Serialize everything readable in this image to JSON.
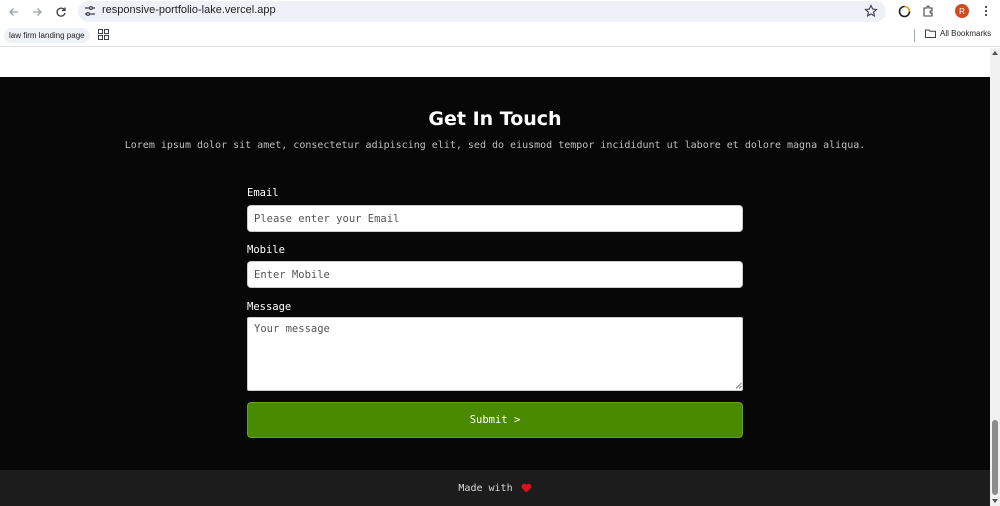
{
  "browser": {
    "url": "responsive-portfolio-lake.vercel.app",
    "profile_initial": "R",
    "bookmarks": [
      {
        "label": "law firm landing page"
      }
    ],
    "all_bookmarks_label": "All Bookmarks"
  },
  "contact": {
    "title": "Get In Touch",
    "subtitle": "Lorem ipsum dolor sit amet, consectetur adipiscing elit, sed do eiusmod tempor incididunt ut labore et dolore magna aliqua.",
    "email": {
      "label": "Email",
      "placeholder": "Please enter your Email",
      "value": ""
    },
    "mobile": {
      "label": "Mobile",
      "placeholder": "Enter Mobile",
      "value": ""
    },
    "message": {
      "label": "Message",
      "placeholder": "Your message",
      "value": ""
    },
    "submit_label": "Submit >"
  },
  "footer": {
    "text": "Made with",
    "heart_color": "#e0101a"
  },
  "colors": {
    "section_bg": "#070707",
    "footer_bg": "#1c1c1c",
    "submit_bg": "#4a8a00"
  }
}
